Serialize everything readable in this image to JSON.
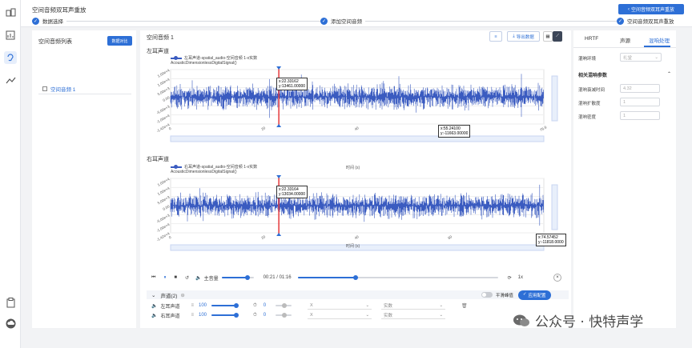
{
  "app_title": "空间音频双耳声重放",
  "header_button": "空间音频双耳声重放",
  "steps": [
    "数据选择",
    "添加空间音频",
    "空间音频双耳声重放"
  ],
  "left_panel": {
    "title": "空间音频列表",
    "compare_button": "数据对比",
    "items": [
      "空间音频 1"
    ]
  },
  "main": {
    "title": "空间音频 1",
    "export_button": "导出数据",
    "channels": [
      {
        "label": "左耳声道",
        "legend": "左耳声道-spatial_audio-空间音频 1-x实数",
        "signal_label": "AcousticDimensionlessDigitalSignal()",
        "y_ticks": [
          "1.00e+4",
          "1.00e+4",
          "5.00e+3",
          "0.00",
          "-5.00e+3",
          "-1.00e+4",
          "-1.42e+4"
        ],
        "x_ticks": [
          "0",
          "20",
          "40",
          "60",
          "76.8"
        ],
        "x_axis_label": "时间 (s)",
        "tooltip1": {
          "x": "x:22.33162",
          "y": "y:13461.00000"
        },
        "tooltip2": {
          "x": "x:55.24100",
          "y": "y:-11663.00000"
        }
      },
      {
        "label": "右耳声道",
        "legend": "右耳声道-spatial_audio-空间音频 1-x实数",
        "signal_label": "AcousticDimensionlessDigitalSignal()",
        "y_ticks": [
          "1.00e+4",
          "1.00e+4",
          "5.00e+3",
          "0.00",
          "-5.00e+3",
          "-1.00e+4",
          "-1.42e+4"
        ],
        "x_ticks": [
          "0",
          "20",
          "40",
          "60",
          "76.8"
        ],
        "x_axis_label": "时间 (s)",
        "tooltip1": {
          "x": "x:22.33164",
          "y": "y:13034.00000"
        },
        "tooltip2": {
          "x": "x:74.57452",
          "y": "y:-11818.0000"
        }
      }
    ],
    "player": {
      "volume_label": "主音量",
      "time": "00:21 / 01:16",
      "speed": "1x",
      "progress_fraction": 0.29,
      "volume_fraction": 0.8
    },
    "channel_table": {
      "header": "声道(2)",
      "smooth_label": "平滑峰值",
      "apply_button": "应用配置",
      "rows": [
        {
          "name": "左耳声道",
          "volume": "100",
          "offset": "0",
          "select1": "X",
          "select2": "实数"
        },
        {
          "name": "右耳声道",
          "volume": "100",
          "offset": "0",
          "select1": "X",
          "select2": "实数"
        }
      ]
    }
  },
  "right_panel": {
    "tabs": [
      "HRTF",
      "声源",
      "混响处理"
    ],
    "reverb_env_label": "混响环境",
    "reverb_env_value": "礼堂",
    "section_title": "相关混响参数",
    "params": [
      {
        "label": "混响衰减时间",
        "value": "4.32"
      },
      {
        "label": "混响扩散度",
        "value": "1"
      },
      {
        "label": "混响密度",
        "value": "1"
      }
    ]
  },
  "watermark": "公众号 · 快特声学",
  "colors": {
    "accent": "#2d6fd6",
    "waveform": "#3a5bc0",
    "cursor": "#e5383b"
  }
}
